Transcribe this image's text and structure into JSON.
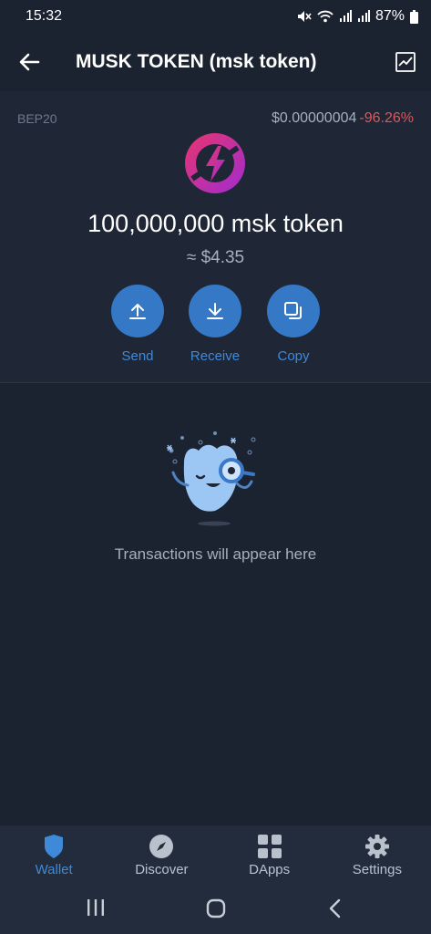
{
  "status_bar": {
    "time": "15:32",
    "battery": "87%"
  },
  "header": {
    "title": "MUSK TOKEN (msk token)",
    "back_icon": "arrow-left-icon",
    "chart_icon": "price-chart-icon"
  },
  "token": {
    "network": "BEP20",
    "price": "$0.00000004",
    "change": "-96.26%",
    "balance": "100,000,000 msk token",
    "fiat_value": "≈ $4.35",
    "logo_icon": "lightning-logo-icon"
  },
  "actions": [
    {
      "label": "Send",
      "icon": "upload-icon"
    },
    {
      "label": "Receive",
      "icon": "download-icon"
    },
    {
      "label": "Copy",
      "icon": "copy-icon"
    }
  ],
  "empty_state": {
    "message": "Transactions will appear here",
    "icon": "mascot-magnifier-icon"
  },
  "bottom_nav": [
    {
      "label": "Wallet",
      "icon": "shield-icon",
      "active": true
    },
    {
      "label": "Discover",
      "icon": "compass-icon",
      "active": false
    },
    {
      "label": "DApps",
      "icon": "grid-icon",
      "active": false
    },
    {
      "label": "Settings",
      "icon": "gear-icon",
      "active": false
    }
  ],
  "colors": {
    "background": "#1b2230",
    "panel": "#1f2635",
    "accent": "#3478c6",
    "accent_text": "#3f8ad8",
    "negative": "#e0565b"
  }
}
